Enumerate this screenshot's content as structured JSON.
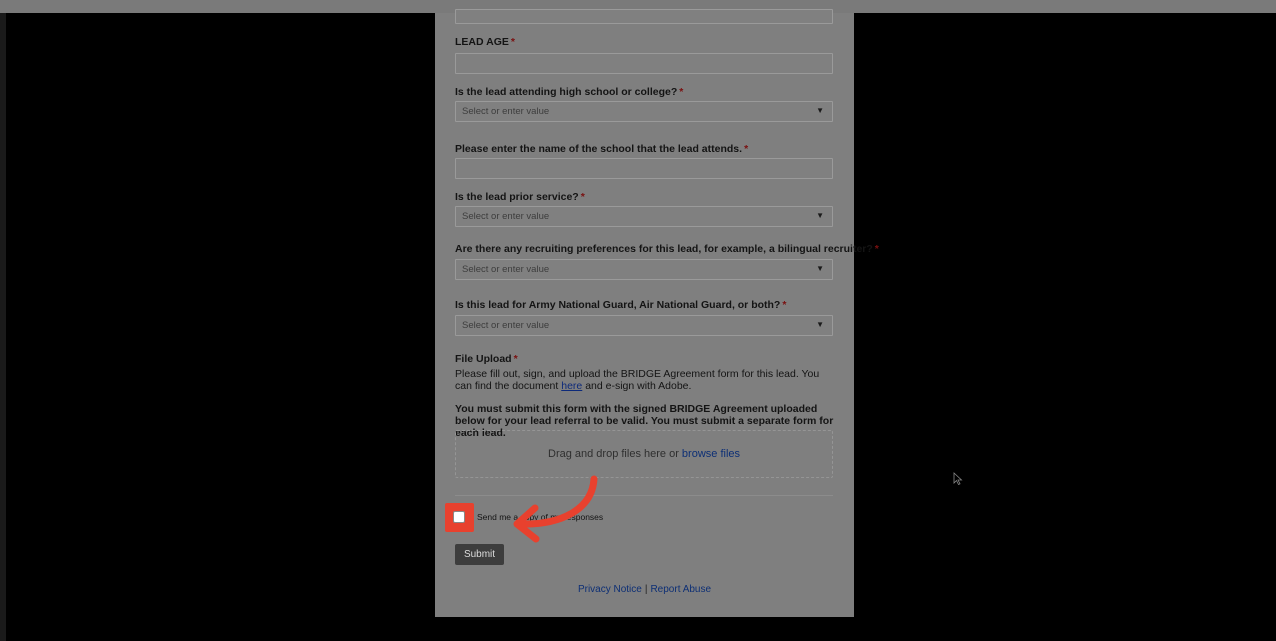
{
  "form": {
    "lead_age_label": "LEAD AGE",
    "school_question": "Is the lead attending high school or college?",
    "school_select_placeholder": "Select or enter value",
    "school_name_question": "Please enter the name of the school that the lead attends.",
    "prior_service_question": "Is the lead prior service?",
    "prior_service_placeholder": "Select or enter value",
    "recruiting_pref_question": "Are there any recruiting preferences for this lead, for example, a bilingual recruiter?",
    "recruiting_pref_placeholder": "Select or enter value",
    "guard_question": "Is this lead for Army National Guard, Air National Guard, or both?",
    "guard_placeholder": "Select or enter value",
    "required_marker": "*",
    "file_upload_label": "File Upload",
    "file_upload_desc_before": "Please fill out, sign, and upload the BRIDGE Agreement form for this lead. You can find the document",
    "file_upload_link": "here",
    "file_upload_desc_after": "and e-sign with Adobe.",
    "submit_notice": "You must submit this form with the signed BRIDGE Agreement uploaded below for your lead referral to be valid. You must submit a separate form for each lead.",
    "dropzone_text": "Drag and drop files here or",
    "dropzone_link": "browse files",
    "copy_checkbox_label": "Send me a copy of my responses",
    "submit_label": "Submit"
  },
  "footer": {
    "privacy_label": "Privacy Notice",
    "separator": "|",
    "report_label": "Report Abuse"
  },
  "colors": {
    "overlay": "#000000",
    "panel": "#7f7f7f",
    "highlight": "#e8412e",
    "link": "#0d2f75"
  }
}
